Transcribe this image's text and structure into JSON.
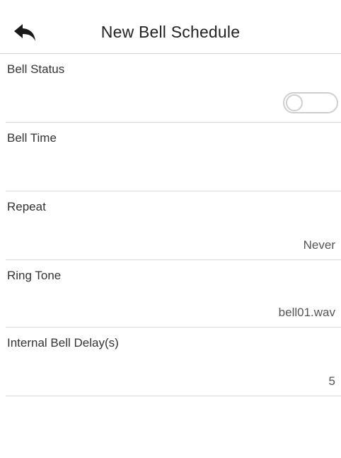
{
  "header": {
    "title": "New Bell Schedule",
    "back_icon": "back-arrow-icon"
  },
  "rows": [
    {
      "label": "Bell Status",
      "value": "",
      "toggle": {
        "state": "off"
      }
    },
    {
      "label": "Bell Time",
      "value": ""
    },
    {
      "label": "Repeat",
      "value": "Never"
    },
    {
      "label": "Ring Tone",
      "value": "bell01.wav"
    },
    {
      "label": "Internal Bell Delay(s)",
      "value": "5"
    }
  ],
  "colors": {
    "divider": "#d6d6d6",
    "text": "#333333",
    "value_text": "#555555",
    "toggle_border": "#cfcfcf"
  }
}
